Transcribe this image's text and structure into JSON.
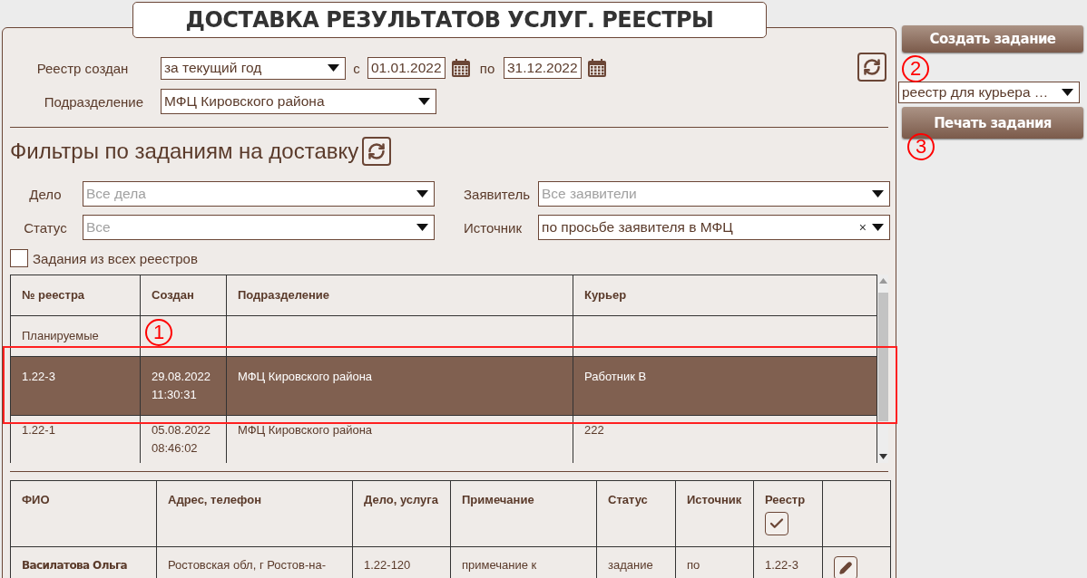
{
  "title": "ДОСТАВКА РЕЗУЛЬТАТОВ УСЛУГ. РЕЕСТРЫ",
  "registry_filter": {
    "created_label": "Реестр создан",
    "period": {
      "value": "за текущий год"
    },
    "from_label": "с",
    "from_date": "01.01.2022",
    "to_label": "по",
    "to_date": "31.12.2022",
    "unit_label": "Подразделение",
    "unit": {
      "value": "МФЦ Кировского района"
    }
  },
  "task_filters": {
    "heading": "Фильтры по заданиям на доставку",
    "fields": [
      {
        "label": "Дело",
        "placeholder": "Все дела"
      },
      {
        "label": "Заявитель",
        "placeholder": "Все заявители"
      },
      {
        "label": "Статус",
        "placeholder": "Все"
      },
      {
        "label": "Источник",
        "value": "по просьбе заявителя в МФЦ",
        "clear": "×"
      }
    ],
    "all_registries": {
      "label": "Задания из всех реестров",
      "checked": false
    }
  },
  "registry_table": {
    "columns": [
      "№ реестра",
      "Создан",
      "Подразделение",
      "Курьер"
    ],
    "rows": [
      {
        "cells": [
          "Планируемые",
          "",
          "",
          ""
        ],
        "selected": false,
        "outlined": false
      },
      {
        "cells": [
          "1.22-3",
          "29.08.2022\n11:30:31",
          "МФЦ Кировского района",
          "Работник В"
        ],
        "selected": true,
        "outlined": true,
        "marker": "1"
      },
      {
        "cells": [
          "1.22-1",
          "05.08.2022\n08:46:02",
          "МФЦ Кировского района",
          "222"
        ],
        "selected": false,
        "outlined": false
      }
    ]
  },
  "tasks_table": {
    "columns": [
      {
        "label": "ФИО"
      },
      {
        "label": "Адрес, телефон"
      },
      {
        "label": "Дело, услуга"
      },
      {
        "label": "Примечание"
      },
      {
        "label": "Статус"
      },
      {
        "label": "Источник"
      },
      {
        "label": "Реестр",
        "kind": "checkbox",
        "checked": true
      }
    ],
    "rows": [
      {
        "cells": [
          "Василатова Ольга",
          "Ростовская обл, г Ростов-на-",
          "1.22-120",
          "примечание к",
          "задание",
          "по",
          "1.22-3"
        ],
        "editable": true
      }
    ]
  },
  "side": {
    "create_button": "Создать задание",
    "print_select": {
      "value": "реестр для курьера …",
      "marker": "2"
    },
    "print_button": {
      "label": "Печать задания",
      "marker": "3"
    }
  }
}
